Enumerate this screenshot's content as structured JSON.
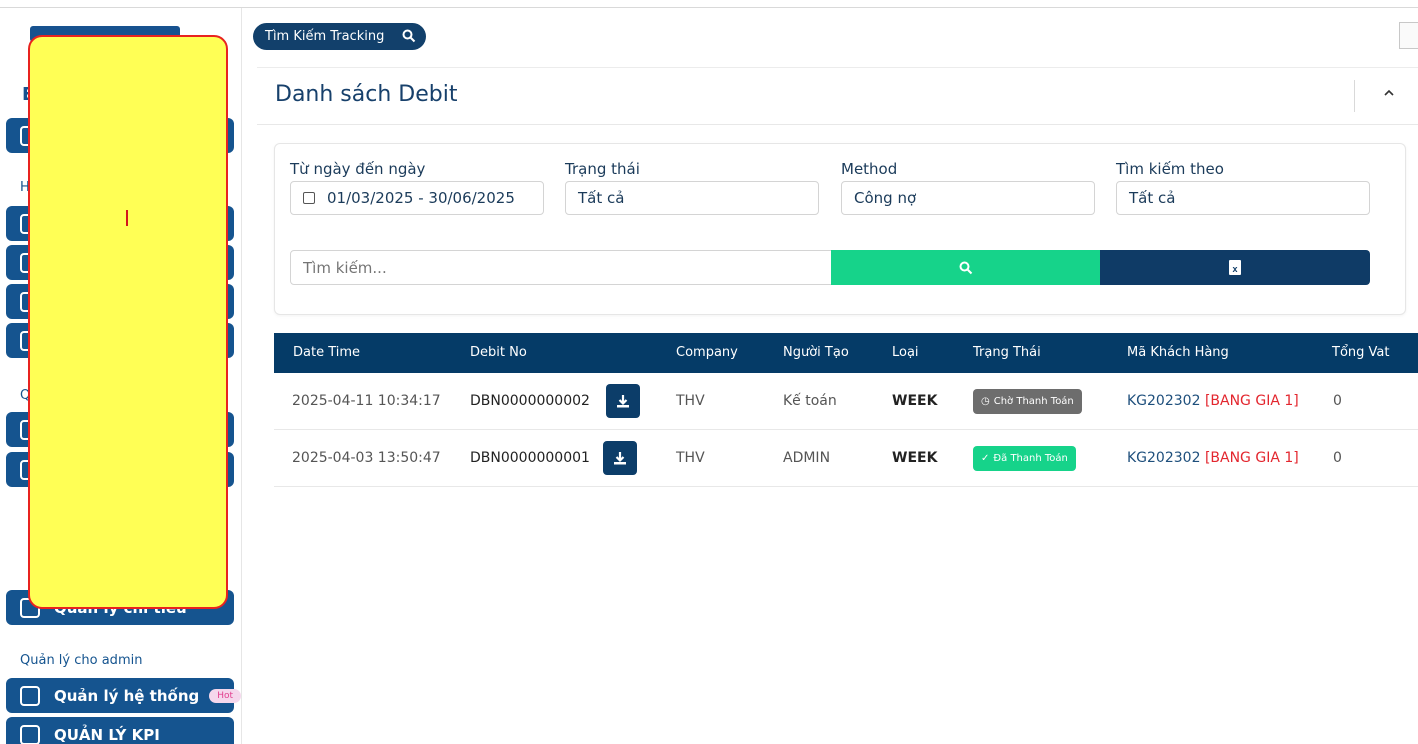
{
  "sidebar": {
    "section_admin": "Quản lý cho admin",
    "items": [
      {
        "label": "Quản lý chi tiêu"
      },
      {
        "label": "Quản lý hệ thống",
        "badge": "Hot"
      },
      {
        "label": "QUẢN LÝ KPI"
      }
    ],
    "fragments": [
      "E",
      "H",
      "Q"
    ]
  },
  "topbar": {
    "tracking_label": "Tìm Kiếm Tracking"
  },
  "page": {
    "title": "Danh sách Debit"
  },
  "filters": {
    "date_label": "Từ ngày đến ngày",
    "date_value": "01/03/2025 - 30/06/2025",
    "status_label": "Trạng thái",
    "status_value": "Tất cả",
    "method_label": "Method",
    "method_value": "Công nợ",
    "searchby_label": "Tìm kiếm theo",
    "searchby_value": "Tất cả",
    "search_placeholder": "Tìm kiếm..."
  },
  "table": {
    "headers": [
      "Date Time",
      "Debit No",
      "Company",
      "Người Tạo",
      "Loại",
      "Trạng Thái",
      "Mã Khách Hàng",
      "Tổng Vat"
    ],
    "rows": [
      {
        "datetime": "2025-04-11 10:34:17",
        "debit_no": "DBN0000000002",
        "company": "THV",
        "creator": "Kế toán",
        "type": "WEEK",
        "status": "Chờ Thanh Toán",
        "customer": "KG202302",
        "price": "[BANG GIA 1]",
        "vat": "0"
      },
      {
        "datetime": "2025-04-03 13:50:47",
        "debit_no": "DBN0000000001",
        "company": "THV",
        "creator": "ADMIN",
        "type": "WEEK",
        "status": "Đã Thanh Toán",
        "customer": "KG202302",
        "price": "[BANG GIA 1]",
        "vat": "0"
      }
    ]
  },
  "colors": {
    "primary": "#053b67",
    "accent_green": "#16d38a",
    "status_wait": "#6d6d6d",
    "price_red": "#e3262e"
  }
}
